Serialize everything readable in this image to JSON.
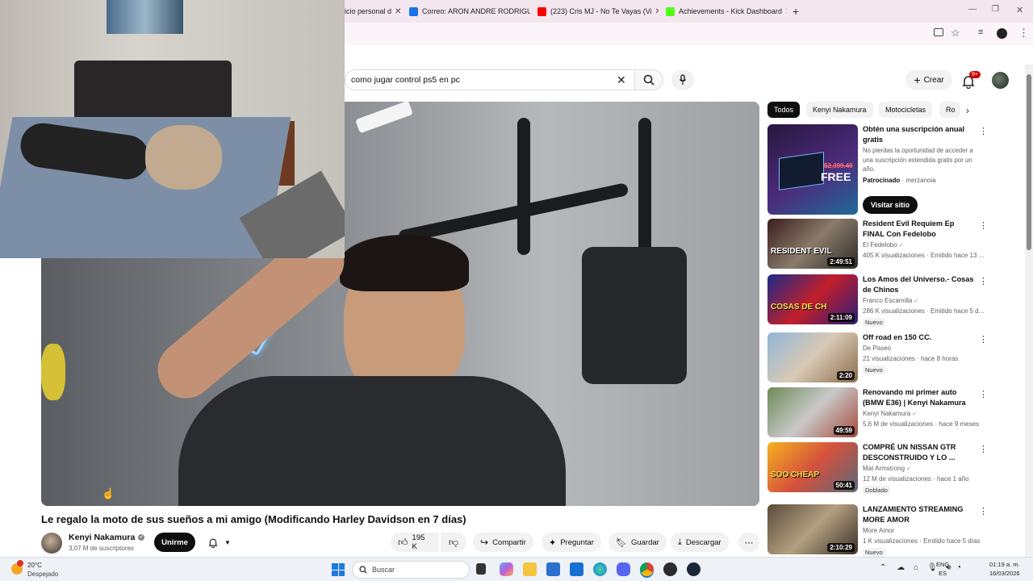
{
  "tabs": [
    {
      "label": "icio personal d",
      "fav_color": "#888888"
    },
    {
      "label": "Correo: ARON ANDRE RODRIGU",
      "fav_color": "#1a73e8"
    },
    {
      "label": "(223) Cris MJ - No Te Vayas (Vi",
      "fav_color": "#ff0000"
    },
    {
      "label": "Achievements - Kick Dashboard",
      "fav_color": "#53fc18"
    }
  ],
  "search": {
    "query": "como jugar control ps5 en pc"
  },
  "header": {
    "create_label": "Crear",
    "notif_count": "9+"
  },
  "video": {
    "title": "Le regalo la moto de sus sueños a mi amigo (Modificando Harley Davidson en 7 días)",
    "channel": "Kenyi Nakamura",
    "subscribers": "3,07 M de suscriptores",
    "join_label": "Unirme",
    "likes": "195 K",
    "share_label": "Compartir",
    "ask_label": "Preguntar",
    "save_label": "Guardar",
    "download_label": "Descargar"
  },
  "chips": [
    "Todos",
    "Kenyi Nakamura",
    "Motocicletas",
    "Ro"
  ],
  "ad": {
    "title": "Obtén una suscripción anual gratis",
    "desc": "No pierdas la oportunidad de acceder a una suscripción extendida gratis por un año.",
    "sponsored": "Patrocinado",
    "advertiser": "merzanoia",
    "cta": "Visitar sitio",
    "thumb_text": "FREE",
    "thumb_price": "$2,399.40"
  },
  "recommendations": [
    {
      "title": "Resident Evil Requiem Ep FINAL Con Fedelobo",
      "channel": "El Fedelobo",
      "meta": "405 K visualizaciones · Emitido hace 13 ...",
      "duration": "2:49:51",
      "badge": "",
      "verified": true
    },
    {
      "title": "Los Amos del Universo.- Cosas de Chinos",
      "channel": "Franco Escamilla",
      "meta": "286 K visualizaciones · Emitido hace 5 d...",
      "duration": "2:11:09",
      "badge": "Nuevo",
      "verified": true
    },
    {
      "title": "Off road en 150 CC.",
      "channel": "De Paseo",
      "meta": "21 visualizaciones · hace 8 horas",
      "duration": "2:20",
      "badge": "Nuevo",
      "verified": false
    },
    {
      "title": "Renovando mi primer auto (BMW E36) | Kenyi Nakamura",
      "channel": "Kenyi Nakamura",
      "meta": "5,6 M de visualizaciones · hace 9 meses",
      "duration": "49:59",
      "badge": "",
      "verified": true
    },
    {
      "title": "COMPRÉ UN NISSAN GTR DESCONSTRUIDO Y LO ...",
      "channel": "Mat Armstrong",
      "meta": "12 M de visualizaciones · hace 1 año",
      "duration": "50:41",
      "badge": "Doblado",
      "verified": true
    },
    {
      "title": "LANZAMIENTO STREAMING MORE AMOR",
      "channel": "More Amor",
      "meta": "1 K visualizaciones · Emitido hace 5 días",
      "duration": "2:10:29",
      "badge": "Nuevo",
      "verified": false
    }
  ],
  "thumb_texts": [
    "RESIDENT EVIL",
    "COSAS DE CH",
    "",
    "",
    "SOO CHEAP",
    ""
  ],
  "taskbar": {
    "weather_temp": "20°C",
    "weather_desc": "Despejado",
    "search_placeholder": "Buscar",
    "lang": "ENG",
    "lang_region": "ES",
    "time": "01:19 a. m.",
    "date": "16/03/2026"
  }
}
